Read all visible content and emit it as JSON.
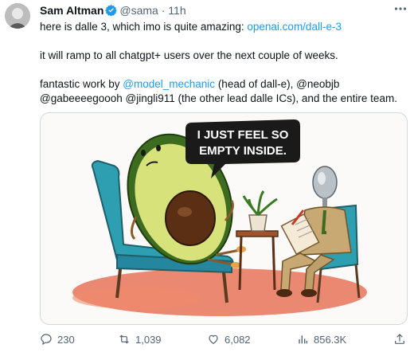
{
  "tweet": {
    "author_name": "Sam Altman",
    "handle": "@sama",
    "separator": "·",
    "time": "11h",
    "line1_text": "here is dalle 3, which imo is quite amazing: ",
    "line1_link": "openai.com/dall-e-3",
    "line2": "it will ramp to all chatgpt+ users over the next couple of weeks.",
    "line3_a": "fantastic work by ",
    "line3_mention": "@model_mechanic",
    "line3_b": " (head of dall-e), @neobjb @gabeeeegoooh @jingli911 (the other lead dalle ICs), and the entire team."
  },
  "image": {
    "speech_line1": "I JUST FEEL SO",
    "speech_line2": "EMPTY INSIDE."
  },
  "actions": {
    "replies": "230",
    "reposts": "1,039",
    "likes": "6,082",
    "views": "856.3K"
  },
  "colors": {
    "accent": "#1d9bf0",
    "muted": "#536471"
  },
  "icons": [
    "more-icon",
    "verified-icon",
    "reply-icon",
    "repost-icon",
    "like-icon",
    "views-icon",
    "share-icon"
  ]
}
